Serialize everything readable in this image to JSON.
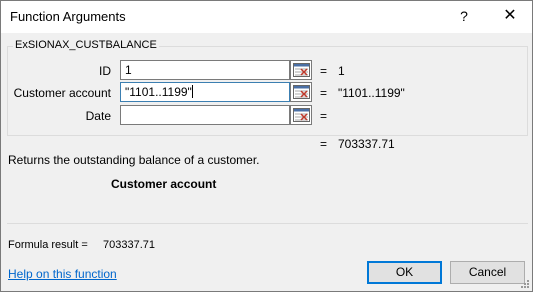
{
  "window": {
    "title": "Function Arguments",
    "help_glyph": "?",
    "close_glyph": "✕"
  },
  "function": {
    "name": "ExSIONAX_CUSTBALANCE",
    "args": [
      {
        "label": "ID",
        "value": "1",
        "result": "1"
      },
      {
        "label": "Customer account",
        "value": "\"1101..1199\"",
        "result": "\"1101..1199\""
      },
      {
        "label": "Date",
        "value": "",
        "result": ""
      }
    ],
    "result_eq": "=",
    "result_value": "703337.71",
    "description": "Returns the outstanding balance of a customer.",
    "current_arg_name": "Customer account"
  },
  "formula": {
    "label": "Formula result =",
    "value": "703337.71"
  },
  "footer": {
    "help_link": "Help on this function",
    "ok_label": "OK",
    "cancel_label": "Cancel"
  },
  "icons": {
    "collapse": "collapse-dialog-icon",
    "help": "help-icon",
    "close": "close-icon",
    "grip": "resize-grip-icon"
  }
}
